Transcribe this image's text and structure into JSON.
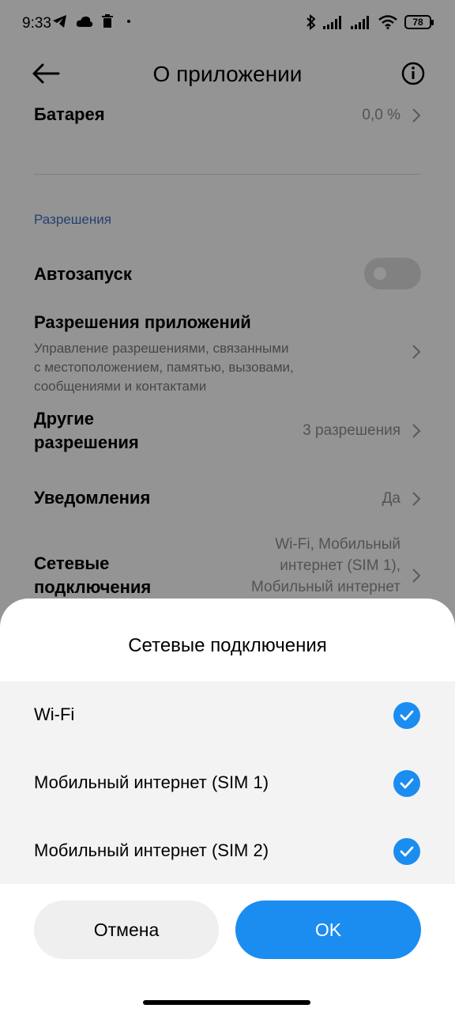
{
  "status_bar": {
    "time": "9:33",
    "left_icons": [
      "telegram-icon",
      "cloud-icon",
      "trash-icon",
      "dot-icon"
    ],
    "right_icons": [
      "bluetooth-icon",
      "signal-icon",
      "signal-icon",
      "wifi-icon"
    ],
    "battery": "78"
  },
  "header": {
    "title": "О приложении"
  },
  "settings": {
    "battery_label": "Батарея",
    "battery_value": "0,0 %",
    "permissions_section": "Разрешения",
    "autostart_label": "Автозапуск",
    "autostart_enabled": false,
    "app_permissions_label": "Разрешения приложений",
    "app_permissions_desc": [
      "Управление разрешениями, связанными",
      "с местоположением, памятью, вызовами,",
      "сообщениями и контактами"
    ],
    "other_permissions_label": [
      "Другие",
      "разрешения"
    ],
    "other_permissions_value": "3 разрешения",
    "notifications_label": "Уведомления",
    "notifications_value": "Да",
    "network_label": [
      "Сетевые",
      "подключения"
    ],
    "network_value": [
      "Wi-Fi, Мобильный",
      "интернет (SIM 1),",
      "Мобильный интернет"
    ]
  },
  "sheet": {
    "title": "Сетевые подключения",
    "options": [
      {
        "label": "Wi-Fi",
        "checked": true
      },
      {
        "label": "Мобильный интернет (SIM 1)",
        "checked": true
      },
      {
        "label": "Мобильный интернет (SIM 2)",
        "checked": true
      }
    ],
    "cancel_label": "Отмена",
    "ok_label": "OK"
  },
  "colors": {
    "accent": "#1b8cf0",
    "section_label": "#3f6fbf"
  }
}
